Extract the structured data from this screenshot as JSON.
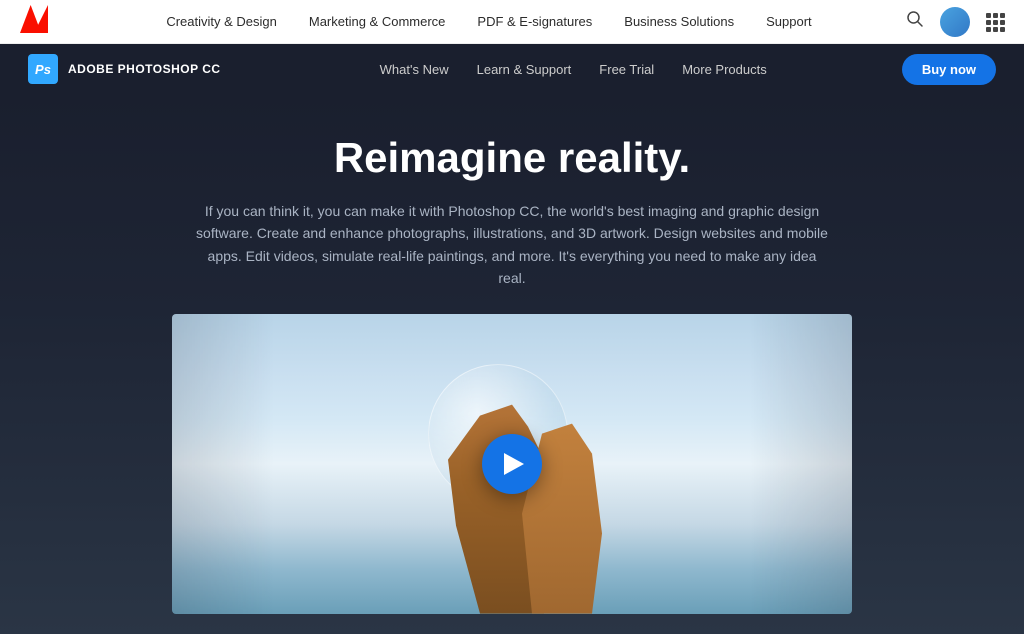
{
  "topNav": {
    "logoAlt": "Adobe",
    "links": [
      {
        "label": "Creativity & Design",
        "id": "creativity-design"
      },
      {
        "label": "Marketing & Commerce",
        "id": "marketing-commerce"
      },
      {
        "label": "PDF & E-signatures",
        "id": "pdf-esignatures"
      },
      {
        "label": "Business Solutions",
        "id": "business-solutions"
      },
      {
        "label": "Support",
        "id": "support"
      }
    ]
  },
  "productNav": {
    "logoText": "Ps",
    "productTitle": "ADOBE PHOTOSHOP CC",
    "links": [
      {
        "label": "What's New",
        "id": "whats-new"
      },
      {
        "label": "Learn & Support",
        "id": "learn-support"
      },
      {
        "label": "Free Trial",
        "id": "free-trial"
      },
      {
        "label": "More Products",
        "id": "more-products"
      }
    ],
    "buyButtonLabel": "Buy now"
  },
  "hero": {
    "title": "Reimagine reality.",
    "subtitle": "If you can think it, you can make it with Photoshop CC, the world's best imaging and graphic design software. Create and enhance photographs, illustrations, and 3D artwork. Design websites and mobile apps. Edit videos, simulate real-life paintings, and more. It's everything you need to make any idea real.",
    "videoAriaLabel": "Photoshop CC product video"
  }
}
